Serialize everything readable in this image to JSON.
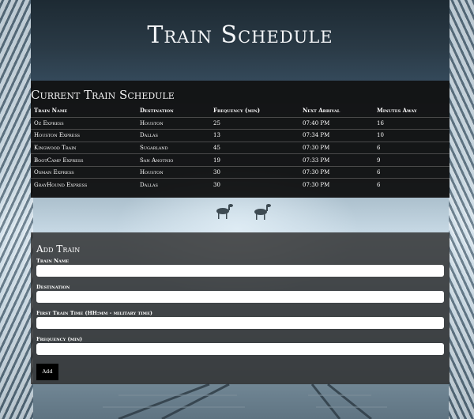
{
  "header": {
    "title": "Train Schedule"
  },
  "schedule": {
    "heading": "Current Train Schedule",
    "columns": [
      "Train Name",
      "Destination",
      "Frequency (min)",
      "Next Arrival",
      "Minutes Away"
    ],
    "rows": [
      [
        "Oz Express",
        "Houston",
        "25",
        "07:40 PM",
        "16"
      ],
      [
        "Houston Express",
        "Dallas",
        "13",
        "07:34 PM",
        "10"
      ],
      [
        "Kingwood Train",
        "Sugarland",
        "45",
        "07:30 PM",
        "6"
      ],
      [
        "BootCamp Express",
        "San Anotnio",
        "19",
        "07:33 PM",
        "9"
      ],
      [
        "Osman Express",
        "Houston",
        "30",
        "07:30 PM",
        "6"
      ],
      [
        "GrayHound Express",
        "Dallas",
        "30",
        "07:30 PM",
        "6"
      ]
    ]
  },
  "form": {
    "heading": "Add Train",
    "train_name_label": "Train Name",
    "destination_label": "Destination",
    "first_time_label": "First Train Time (HH:mm - military time)",
    "frequency_label": "Frequency (min)",
    "add_label": "Add"
  }
}
